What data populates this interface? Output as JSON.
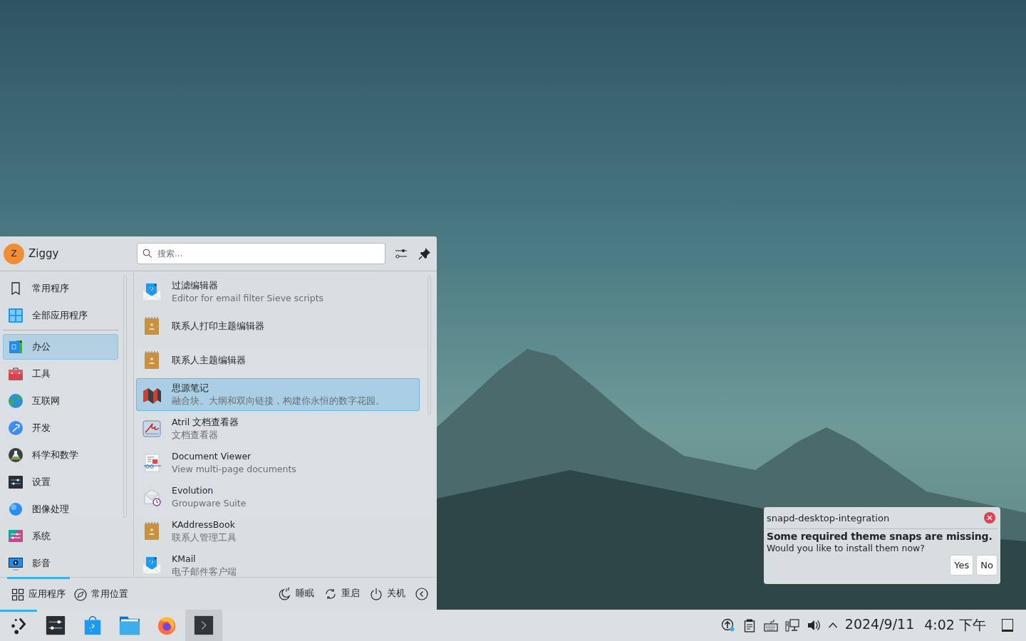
{
  "launcher": {
    "user": {
      "initial": "Z",
      "name": "Ziggy"
    },
    "search": {
      "placeholder": "搜索..."
    },
    "views": [
      {
        "label": "常用程序",
        "kind": "bookmark",
        "selected": false
      },
      {
        "label": "全部应用程序",
        "kind": "allapps",
        "selected": false
      }
    ],
    "categories": [
      {
        "label": "办公",
        "kind": "office",
        "selected": true
      },
      {
        "label": "工具",
        "kind": "toolbox",
        "selected": false
      },
      {
        "label": "互联网",
        "kind": "globe",
        "selected": false
      },
      {
        "label": "开发",
        "kind": "dev",
        "selected": false
      },
      {
        "label": "科学和数学",
        "kind": "science",
        "selected": false
      },
      {
        "label": "设置",
        "kind": "settings",
        "selected": false
      },
      {
        "label": "图像处理",
        "kind": "graphics",
        "selected": false
      },
      {
        "label": "系统",
        "kind": "system",
        "selected": false
      },
      {
        "label": "影音",
        "kind": "media",
        "selected": false
      }
    ],
    "apps": [
      {
        "name": "过滤编辑器",
        "description": "Editor for email filter Sieve scripts",
        "kind": "mail",
        "selected": false
      },
      {
        "name": "联系人打印主题编辑器",
        "kind": "addressbook",
        "selected": false
      },
      {
        "name": "联系人主题编辑器",
        "kind": "addressbook",
        "selected": false
      },
      {
        "name": "思源笔记",
        "description": "融合块、大纲和双向链接，构建你永恒的数字花园。",
        "kind": "siyuan",
        "selected": true
      },
      {
        "name": "Atril 文档查看器",
        "description": "文档查看器",
        "kind": "atril",
        "selected": false
      },
      {
        "name": "Document Viewer",
        "description": "View multi-page documents",
        "kind": "docviewer",
        "selected": false
      },
      {
        "name": "Evolution",
        "description": "Groupware Suite",
        "kind": "evolution",
        "selected": false
      },
      {
        "name": "KAddressBook",
        "description": "联系人管理工具",
        "kind": "addressbook",
        "selected": false
      },
      {
        "name": "KMail",
        "description": "电子邮件客户端",
        "kind": "mail",
        "selected": false
      }
    ],
    "footer_tabs": [
      {
        "label": "应用程序",
        "kind": "grid",
        "selected": true
      },
      {
        "label": "常用位置",
        "kind": "compass",
        "selected": false
      }
    ],
    "power_actions": [
      {
        "label": "睡眠",
        "kind": "sleep"
      },
      {
        "label": "重启",
        "kind": "restart"
      },
      {
        "label": "关机",
        "kind": "shutdown"
      }
    ]
  },
  "notification": {
    "app": "snapd-desktop-integration",
    "heading": "Some required theme snaps are missing.",
    "body": "Would you like to install them now?",
    "buttons": [
      "Yes",
      "No"
    ]
  },
  "taskbar": {
    "tasks": [
      {
        "kind": "launcher",
        "active": true,
        "hovered": false
      },
      {
        "kind": "settings",
        "active": false,
        "hovered": false
      },
      {
        "kind": "store",
        "active": false,
        "hovered": false
      },
      {
        "kind": "files",
        "active": false,
        "hovered": false
      },
      {
        "kind": "firefox",
        "active": false,
        "hovered": false
      },
      {
        "kind": "terminal",
        "active": false,
        "hovered": true
      }
    ],
    "tray": [
      {
        "kind": "update"
      },
      {
        "kind": "clipboard"
      },
      {
        "kind": "keyboard"
      },
      {
        "kind": "network"
      },
      {
        "kind": "volume"
      },
      {
        "kind": "expand"
      }
    ],
    "date": "2024/9/11",
    "time": "4:02 下午"
  }
}
